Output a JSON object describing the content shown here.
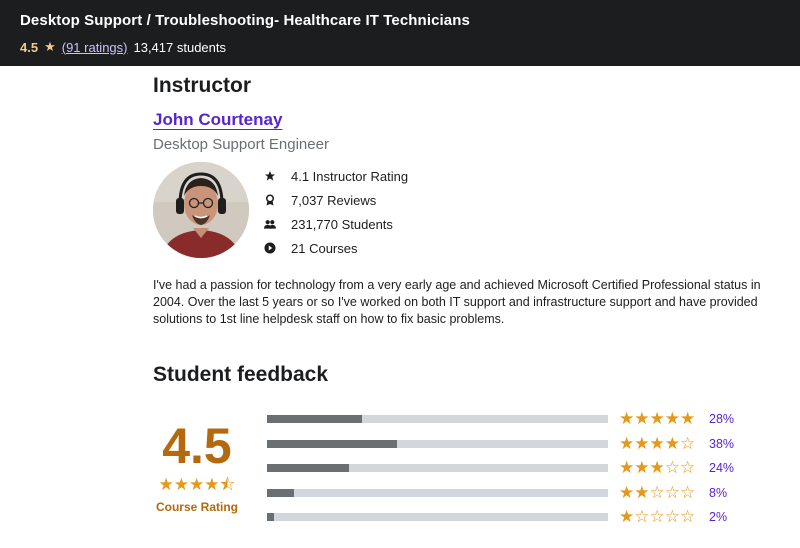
{
  "header": {
    "course_title": "Desktop Support / Troubleshooting- Healthcare IT Technicians",
    "rating": "4.5",
    "ratings_link": "(91 ratings)",
    "students": "13,417 students"
  },
  "instructor": {
    "heading": "Instructor",
    "name": "John Courtenay",
    "job_title": "Desktop Support Engineer",
    "stats": [
      {
        "icon": "star-icon",
        "label": "4.1 Instructor Rating"
      },
      {
        "icon": "award-icon",
        "label": "7,037 Reviews"
      },
      {
        "icon": "users-icon",
        "label": "231,770 Students"
      },
      {
        "icon": "play-icon",
        "label": "21 Courses"
      }
    ],
    "bio": "I've had a passion for technology from a very early age and achieved Microsoft Certified Professional status in 2004. Over the last 5 years or so I've worked on both IT support and infrastructure support and have provided solutions to 1st line helpdesk staff on how to fix basic problems."
  },
  "feedback": {
    "heading": "Student feedback",
    "rating": "4.5",
    "stars": "★★★★⯪",
    "rating_label": "Course Rating",
    "distribution": [
      {
        "stars": "★★★★★",
        "percent": "28%",
        "fraction": 0.28
      },
      {
        "stars": "★★★★☆",
        "percent": "38%",
        "fraction": 0.38
      },
      {
        "stars": "★★★☆☆",
        "percent": "24%",
        "fraction": 0.24
      },
      {
        "stars": "★★☆☆☆",
        "percent": "8%",
        "fraction": 0.08
      },
      {
        "stars": "★☆☆☆☆",
        "percent": "2%",
        "fraction": 0.02
      }
    ]
  },
  "colors": {
    "topbar_bg": "#1c1d1f",
    "accent_purple": "#5624d0",
    "rating_brown": "#b4690e",
    "star_orange": "#e59819",
    "bar_fill": "#6a6f73",
    "bar_track": "#d1d7dc"
  }
}
